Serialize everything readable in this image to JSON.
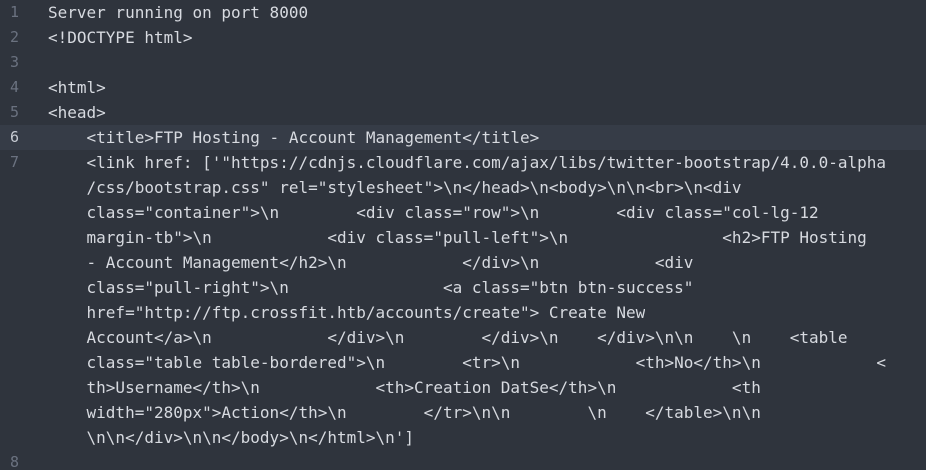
{
  "editor": {
    "lines": [
      {
        "number": "1",
        "text": "Server running on port 8000"
      },
      {
        "number": "2",
        "text": "<!DOCTYPE html>"
      },
      {
        "number": "3",
        "text": ""
      },
      {
        "number": "4",
        "text": "<html>"
      },
      {
        "number": "5",
        "text": "<head>"
      },
      {
        "number": "6",
        "text": "    <title>FTP Hosting - Account Management</title>"
      },
      {
        "number": "7",
        "text": "    <link href: ['\"https://cdnjs.cloudflare.com/ajax/libs/twitter-bootstrap/4.0.0-alpha"
      }
    ],
    "wrapped": [
      "    /css/bootstrap.css\" rel=\"stylesheet\">\\n</head>\\n<body>\\n\\n<br>\\n<div",
      "    class=\"container\">\\n        <div class=\"row\">\\n        <div class=\"col-lg-12",
      "    margin-tb\">\\n            <div class=\"pull-left\">\\n                <h2>FTP Hosting",
      "    - Account Management</h2>\\n            </div>\\n            <div",
      "    class=\"pull-right\">\\n                <a class=\"btn btn-success\"",
      "    href=\"http://ftp.crossfit.htb/accounts/create\"> Create New",
      "    Account</a>\\n            </div>\\n        </div>\\n    </div>\\n\\n    \\n    <table",
      "    class=\"table table-bordered\">\\n        <tr>\\n            <th>No</th>\\n            <",
      "    th>Username</th>\\n            <th>Creation DatSe</th>\\n            <th",
      "    width=\"280px\">Action</th>\\n        </tr>\\n\\n        \\n    </table>\\n\\n",
      "    \\n\\n</div>\\n\\n</body>\\n</html>\\n']"
    ],
    "last_line": {
      "number": "8",
      "text": ""
    }
  }
}
